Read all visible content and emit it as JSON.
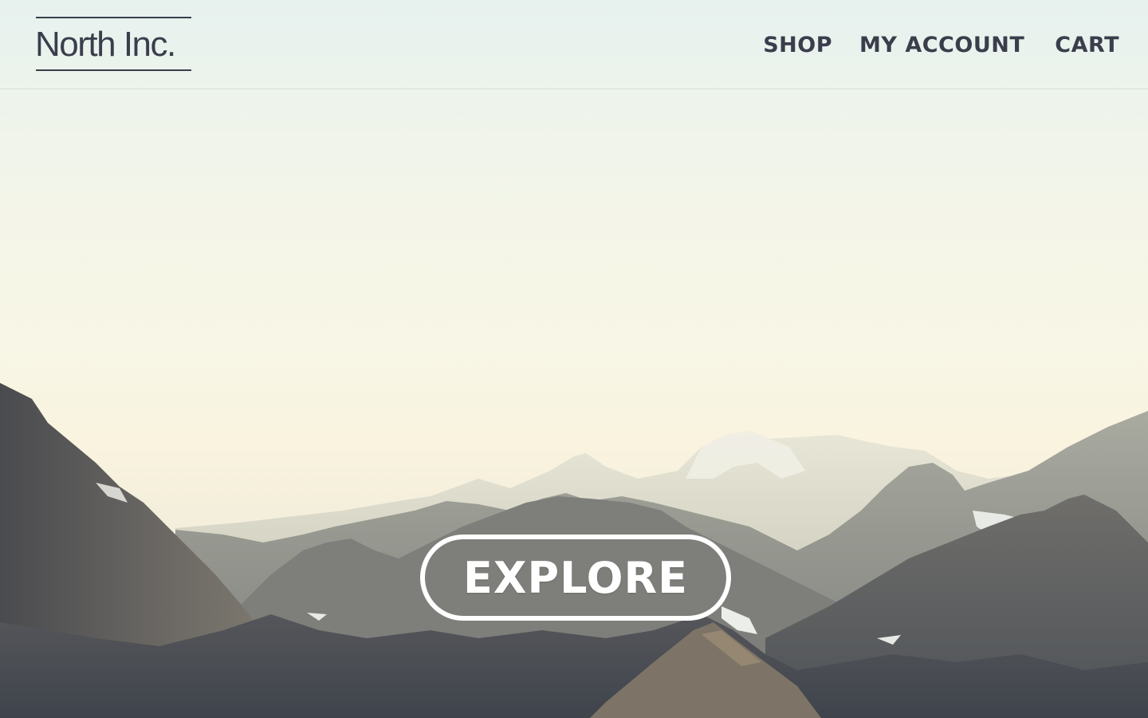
{
  "brand": {
    "name": "North Inc."
  },
  "nav": {
    "items": [
      {
        "label": "SHOP"
      },
      {
        "label": "MY ACCOUNT"
      },
      {
        "label": "CART"
      }
    ]
  },
  "hero": {
    "cta_label": "EXPLORE",
    "image_icon": "mountain-landscape-image"
  },
  "colors": {
    "nav_text": "#3a3e4c",
    "cta": "#ffffff",
    "sky_top": "#e7f1ee",
    "sky_horizon": "#f9f3df"
  }
}
